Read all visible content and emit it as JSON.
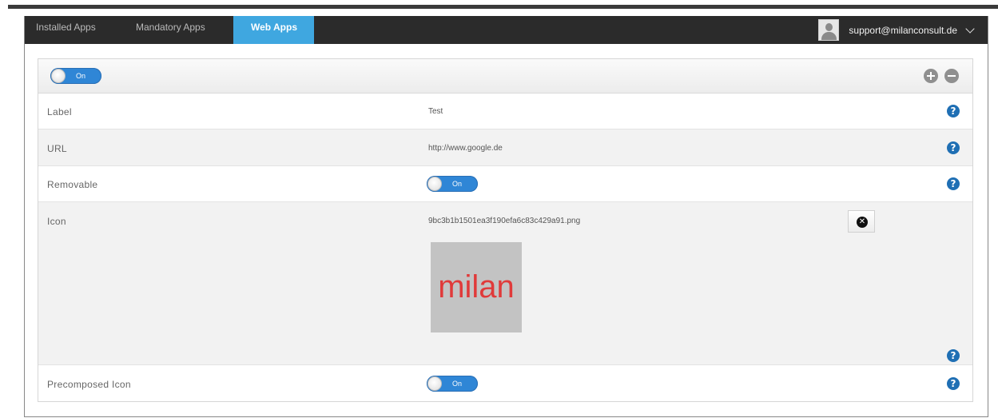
{
  "nav": {
    "tabs": [
      {
        "label": "Installed Apps"
      },
      {
        "label": "Mandatory Apps"
      },
      {
        "label": "Web Apps"
      }
    ],
    "user_email": "support@milanconsult.de"
  },
  "panel": {
    "header_toggle": "On",
    "rows": {
      "label": {
        "label": "Label",
        "value": "Test"
      },
      "url": {
        "label": "URL",
        "value": "http://www.google.de"
      },
      "removable": {
        "label": "Removable",
        "toggle": "On"
      },
      "icon": {
        "label": "Icon",
        "filename": "9bc3b1b1501ea3f190efa6c83c429a91.png",
        "preview_text": "milan"
      },
      "precomposed": {
        "label": "Precomposed Icon",
        "toggle": "On"
      }
    },
    "help_glyph": "?",
    "remove_glyph": "✕"
  },
  "colors": {
    "accent": "#3fa7e0",
    "navbar": "#2b2b2b",
    "toggle": "#2f86d6",
    "help": "#1f6fb4",
    "preview_text": "#e03a3a"
  }
}
